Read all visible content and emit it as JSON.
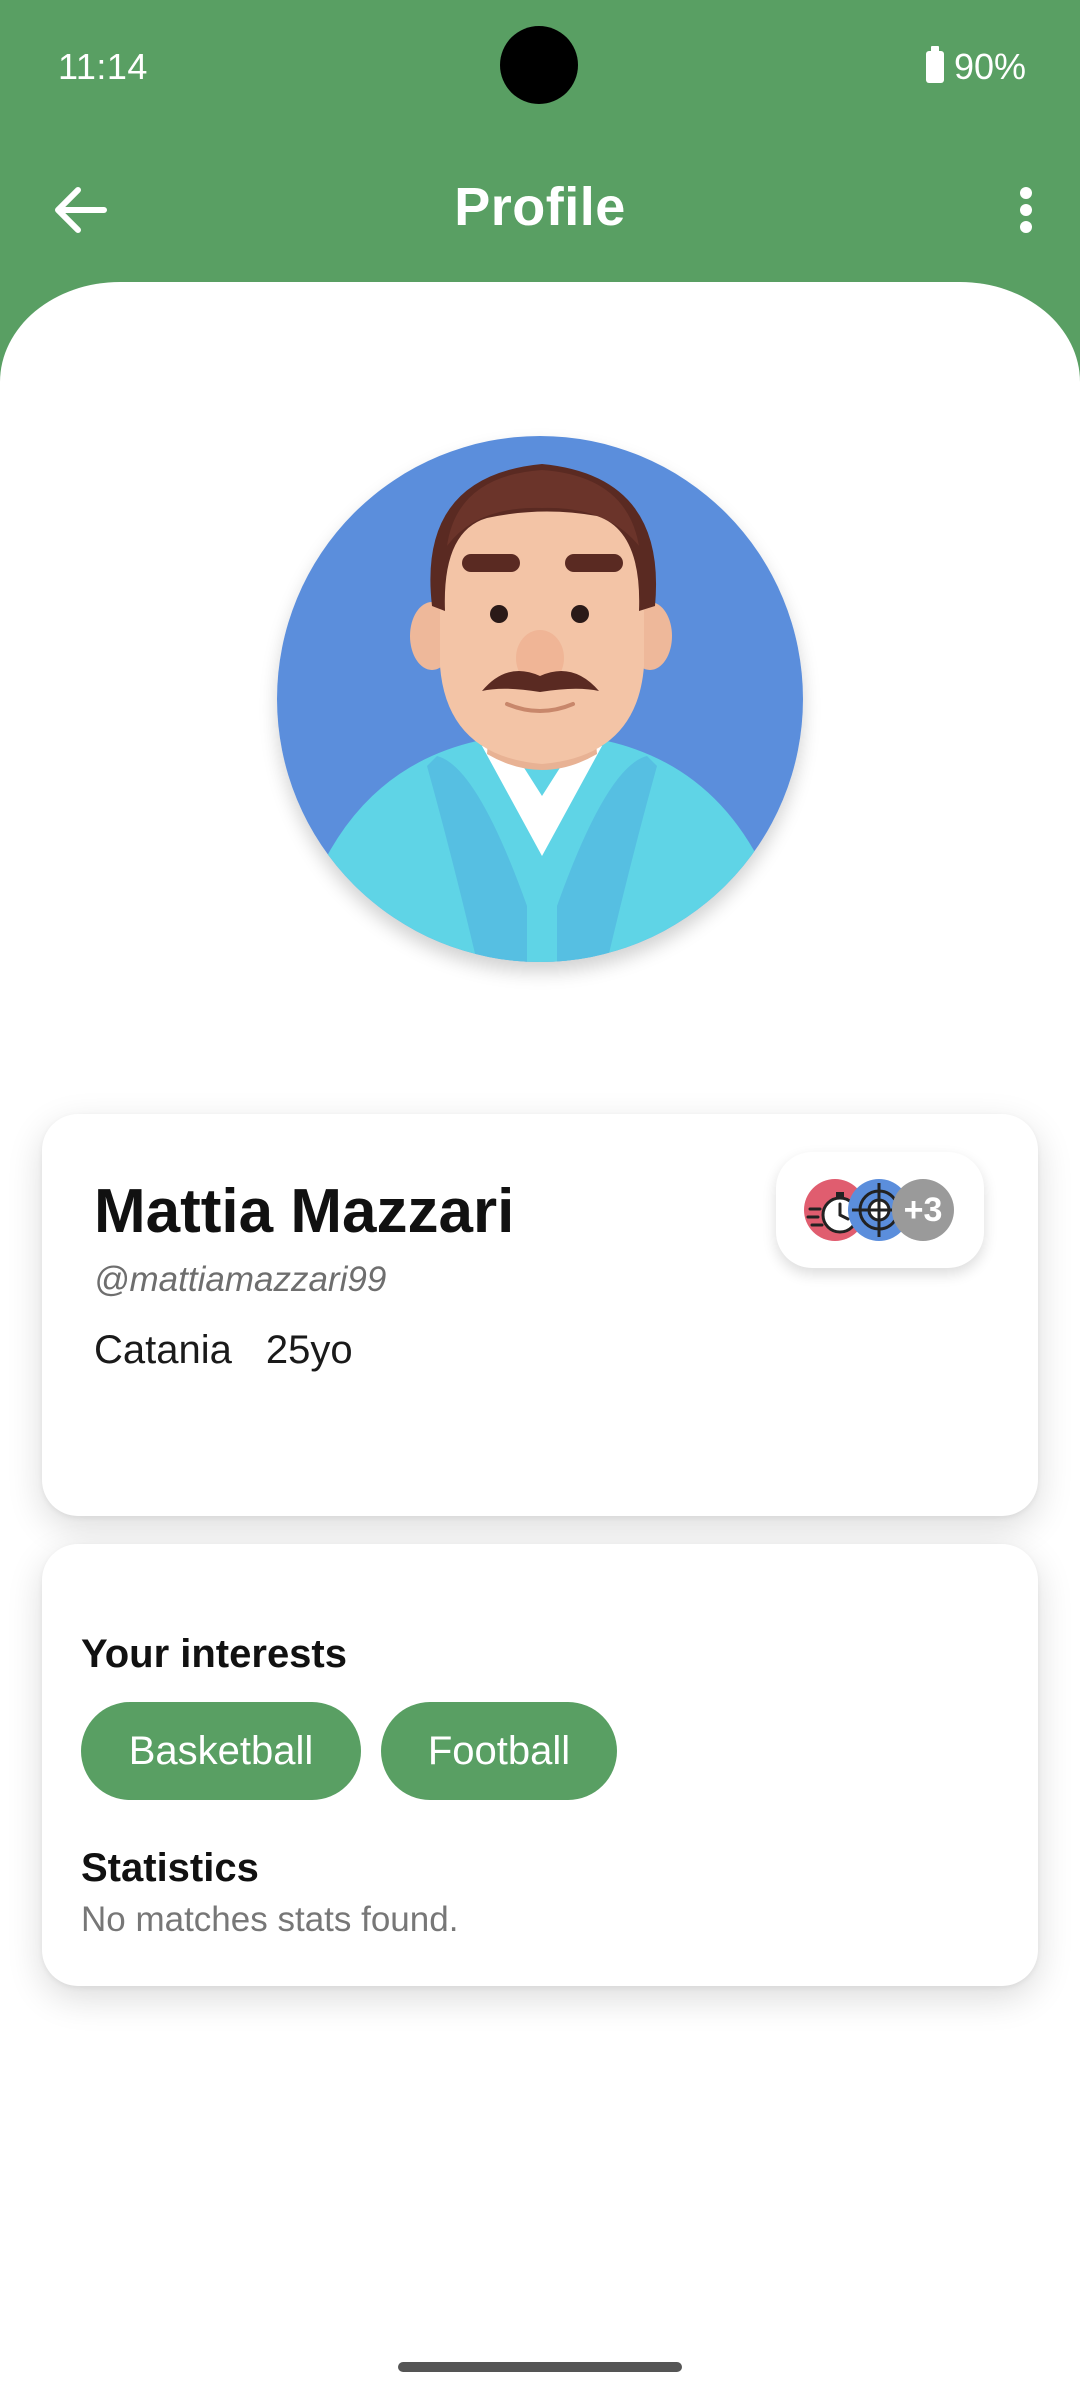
{
  "status_bar": {
    "time": "11:14",
    "battery": "90%"
  },
  "app_bar": {
    "title": "Profile",
    "back_icon": "arrow-left-icon",
    "more_icon": "more-vert-icon"
  },
  "colors": {
    "primary": "#599f63",
    "avatar_background": "#5b8edc"
  },
  "profile": {
    "name": "Mattia Mazzari",
    "username": "@mattiamazzari99",
    "city": "Catania",
    "age": "25yo",
    "badges": {
      "icons": [
        "stopwatch-icon",
        "target-icon"
      ],
      "more_count": "+3"
    }
  },
  "interests": {
    "title": "Your interests",
    "items": [
      "Basketball",
      "Football"
    ]
  },
  "statistics": {
    "title": "Statistics",
    "empty_text": "No matches stats found."
  }
}
